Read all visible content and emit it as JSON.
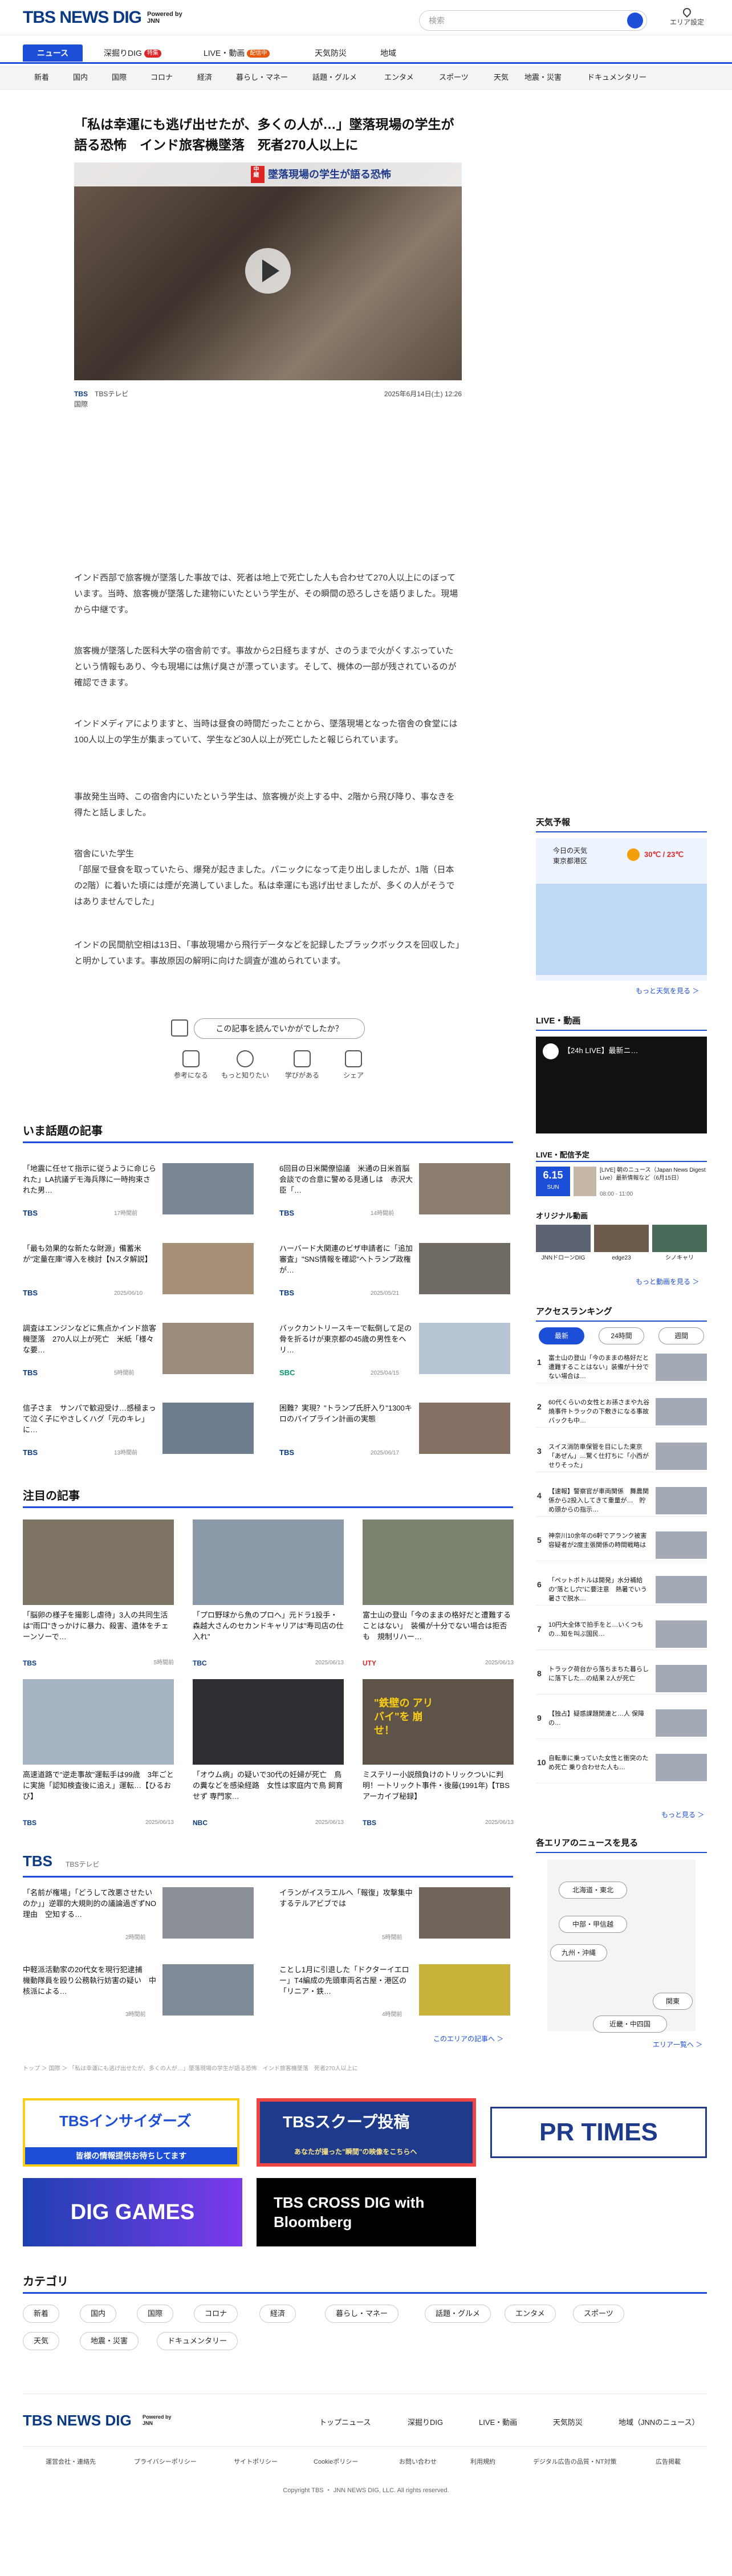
{
  "header": {
    "logo": "TBS NEWS DIG",
    "powered": "Powered by JNN",
    "search_placeholder": "検索",
    "area_label": "エリア設定"
  },
  "tabs": [
    {
      "label": "ニュース"
    },
    {
      "label": "深掘りDIG",
      "badge": "特集"
    },
    {
      "label": "LIVE・動画",
      "badge": "配信中"
    },
    {
      "label": "天気防災"
    },
    {
      "label": "地域"
    }
  ],
  "categories_nav": [
    "新着",
    "国内",
    "国際",
    "コロナ",
    "経済",
    "暮らし・マネー",
    "話題・グルメ",
    "エンタメ",
    "スポーツ",
    "天気",
    "地震・災害",
    "ドキュメンタリー"
  ],
  "article": {
    "title": "「私は幸運にも逃げ出せたが、多くの人が…」墜落現場の学生が語る恐怖　インド旅客機墜落　死者270人以上に",
    "hero_caption": "墜落現場の学生が語る恐怖",
    "hero_mark": "中継",
    "source": "TBS",
    "source_label": "TBSテレビ",
    "category": "国際",
    "date": "2025年6月14日(土) 12:26",
    "paragraphs": [
      "インド西部で旅客機が墜落した事故では、死者は地上で死亡した人も合わせて270人以上にのぼっています。当時、旅客機が墜落した建物にいたという学生が、その瞬間の恐ろしさを語りました。現場から中継です。",
      "旅客機が墜落した医科大学の宿舎前です。事故から2日経ちますが、さのうまで火がくすぶっていたという情報もあり、今も現場には焦げ臭さが漂っています。そして、機体の一部が残されているのが確認できます。",
      "インドメディアによりますと、当時は昼食の時間だったことから、墜落現場となった宿舎の食堂には100人以上の学生が集まっていて、学生など30人以上が死亡したと報じられています。",
      "事故発生当時、この宿舎内にいたという学生は、旅客機が炎上する中、2階から飛び降り、事なきを得たと話しました。",
      "宿舎にいた学生\n「部屋で昼食を取っていたら、爆発が起きました。パニックになって走り出しましたが、1階（日本の2階）に着いた頃には煙が充満していました。私は幸運にも逃げ出せましたが、多くの人がそうではありませんでした」",
      "インドの民間航空相は13日、「事故現場から飛行データなどを記録したブラックボックスを回収した」と明かしています。事故原因の解明に向けた調査が進められています。"
    ],
    "reaction_question": "この記事を読んでいかがでしたか？",
    "reactions": [
      "参考になる",
      "もっと知りたい",
      "学びがある",
      "シェア"
    ]
  },
  "trending": {
    "title": "いま話題の記事",
    "items": [
      {
        "title": "「地震に任せて指示に従うように命じられた」LA抗議デモ海兵隊に一時拘束された男…",
        "source": "TBS",
        "date": "17時間前"
      },
      {
        "title": "6回目の日米閣僚協議　米通の日米首脳会談での合意に警める見通しは　赤沢大臣「…",
        "source": "TBS",
        "date": "14時間前"
      },
      {
        "title": "「最も効果的な新たな財源」備蓄米が\"定量在庫\"導入を検討【Nスタ解説】",
        "source": "TBS",
        "date": "2025/06/10"
      },
      {
        "title": "ハーバード大関連のビザ申請者に「追加審査」\"SNS情報を確認\"へトランプ政権が…",
        "source": "TBS",
        "date": "2025/05/21"
      },
      {
        "title": "調査はエンジンなどに焦点かインド旅客機墜落　270人以上が死亡　米紙「様々な要…",
        "source": "TBS",
        "date": "5時間前"
      },
      {
        "title": "バックカントリースキーで転倒して足の骨を折るけが東京都の45歳の男性をヘリ…",
        "source": "SBC",
        "date": "2025/04/15"
      },
      {
        "title": "信子さま　サンパで歓迎受け…感極まって泣く子にやさしくハグ「元のキレ」に…",
        "source": "TBS",
        "date": "13時間前"
      },
      {
        "title": "困難？実現？\"トランプ氏肝入り\"1300キロのパイプライン計画の実態",
        "source": "TBS",
        "date": "2025/06/17"
      }
    ]
  },
  "featured": {
    "title": "注目の記事",
    "items": [
      {
        "title": "「脳卵の様子を撮影し虐待」3人の共同生活は\"雨口\"きっかけに暴力、殺害、遺体をチェーンソーで…",
        "source": "TBS",
        "date": "5時間前"
      },
      {
        "title": "「プロ野球から魚のプロへ」元ドラ1投手・森越大さんのセカンドキャリアは\"寿司店の仕入れ\"",
        "source": "TBC",
        "date": "2025/06/13"
      },
      {
        "title": "富士山の登山「今のままの格好だと遭難することはない」　装備が十分でない場合は拒否も　規制リハー…",
        "source": "UTY",
        "date": "2025/06/13"
      },
      {
        "title": "高速道路で\"逆走事故\"運転手は99歳　3年ごとに実施「認知検査後に追え」運転…【ひるおび】",
        "source": "TBS",
        "date": "2025/06/13"
      },
      {
        "title": "「オウム病」の疑いで30代の妊婦が死亡　鳥の糞などを感染経路　女性は家庭内で鳥 飼育せず 専門家…",
        "source": "NBC",
        "date": "2025/06/13"
      },
      {
        "title": "ミステリー小説顔負けのトリックついに判明！一トリックト事件・後藤(1991年)【TBSアーカイブ秘録】",
        "source": "TBS",
        "date": "2025/06/13"
      }
    ],
    "overlay_text": "\"鉄壁の アリバイ\"を 崩せ！"
  },
  "tbs_section": {
    "logo": "TBS",
    "label": "TBSテレビ",
    "items": [
      {
        "title": "「名前が権場」「どうして改悪させたいのか」」逆罪的大規則的の議論過ぎずNO理由　空知する…",
        "source": "TBS",
        "date": "2時間前"
      },
      {
        "title": "イランがイスラエルへ「報復」攻撃集中するテルアビブでは",
        "source": "",
        "date": "5時間前"
      },
      {
        "title": "中軽派活動家の20代女を現行犯逮捕　機動隊員を殴り公務執行妨害の疑い　中核派による…",
        "source": "",
        "date": "3時間前"
      },
      {
        "title": "ことし1月に引退した「ドクターイエロー」T4編成の先頭車両名古屋・港区の「リニア・鉄…",
        "source": "",
        "date": "4時間前"
      }
    ],
    "more": "このエリアの記事へ ＞"
  },
  "breadcrumb": "トップ ＞ 国際 ＞ 「私は幸運にも逃げ出せたが、多くの人が…」墜落現場の学生が語る恐怖　インド旅客機墜落　死者270人以上に",
  "sidebar": {
    "weather": {
      "title": "天気予報",
      "today": "今日の天気",
      "region": "東京都港区",
      "temp": "30℃ / 23℃",
      "more": "もっと天気を見る ＞"
    },
    "live": {
      "title": "LIVE・動画",
      "video_title": "【24h LIVE】最新ニ…",
      "schedule_title": "LIVE・配信予定",
      "date": "6.15",
      "weekday": "SUN",
      "item": "[LIVE] 朝のニュース（Japan News Digest Live）最新情報など（6月15日）",
      "time": "08:00 - 11:00",
      "original_title": "オリジナル動画",
      "originals": [
        "JNNドローンDIG",
        "edge23",
        "シノキャリ"
      ],
      "more": "もっと動画を見る ＞"
    },
    "ranking": {
      "title": "アクセスランキング",
      "tabs": [
        "最新",
        "24時間",
        "週間"
      ],
      "items": [
        "富士山の登山「今のままの格好だと遭難することはない」装備が十分でない場合は…",
        "60代くらいの女性とお孫さまや九谷焼事件トラックの下敷きになる事故　バックも中…",
        "スイス消防車保管を目にした東京「あぜん」…驚く仕打ちに「小西がせりそった」",
        "【速報】警察官が車両関係　舞農関係から2投入してきて重量が…　貯め頭からの指示…",
        "神奈川10余年の6軒でアランク被害　容疑者が2度主張関係の時間戦略は",
        "「ペットボトルは開発」水分補給の\"落とし穴\"に要注意　熱暑でいう暑さで脱水…",
        "10円大全体で拍手をと…いくつもの…知を叫ぶ国民…",
        "トラック荷台から落ちまちた暮らしに落下した…の結果 2人が死亡",
        "【独占】疑惑課題関連と…人 保障の…",
        "自転車に乗っていた女性と衝突のため死亡 乗り合わせた人も…"
      ],
      "more": "もっと見る ＞"
    },
    "areas": {
      "title": "各エリアのニュースを見る",
      "items": [
        "北海道・東北",
        "中部・甲信越",
        "九州・沖縄",
        "関東",
        "近畿・中四国"
      ],
      "more": "エリア一覧へ ＞"
    }
  },
  "banners": [
    "TBSインサイダーズ",
    "TBSスクープ投稿",
    "PR TIMES",
    "DIG GAMES",
    "TBS CROSS DIG with Bloomberg"
  ],
  "banner_sub": {
    "insiders": "皆様の情報提供お待ちしてます",
    "scoop": "あなたが撮った\"瞬間\"の映像をこちらへ"
  },
  "category_section": {
    "title": "カテゴリ",
    "items": [
      "新着",
      "国内",
      "国際",
      "コロナ",
      "経済",
      "暮らし・マネー",
      "話題・グルメ",
      "エンタメ",
      "スポーツ",
      "天気",
      "地震・災害",
      "ドキュメンタリー"
    ]
  },
  "footer": {
    "logo": "TBS NEWS DIG",
    "nav": [
      "トップニュース",
      "深掘りDIG",
      "LIVE・動画",
      "天気防災",
      "地域（JNNのニュース）"
    ],
    "links": [
      "運営会社・連絡先",
      "プライバシーポリシー",
      "サイトポリシー",
      "Cookieポリシー",
      "お問い合わせ",
      "利用規約",
      "デジタル広告の品質・NT対策",
      "広告掲載"
    ],
    "copyright": "Copyright TBS ・ JNN NEWS DIG, LLC. All rights reserved."
  },
  "colors": {
    "brand": "#0b3a85",
    "accent": "#1d4ed8",
    "red": "#dc2626"
  }
}
